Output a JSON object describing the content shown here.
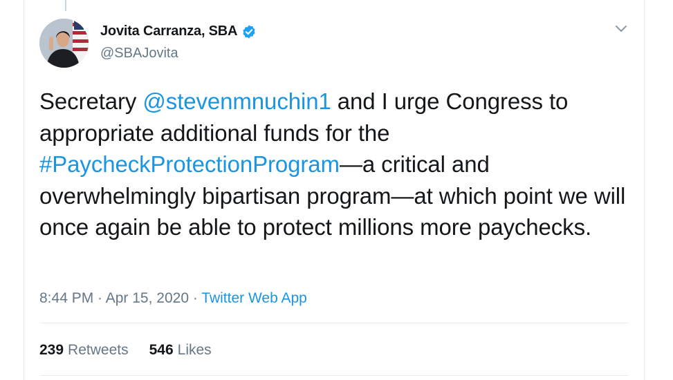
{
  "author": {
    "name": "Jovita Carranza, SBA",
    "handle": "@SBAJovita",
    "verified": true
  },
  "tweet": {
    "t1": "Secretary ",
    "mention": "@stevenmnuchin1",
    "t2": " and I urge Congress to appropriate additional funds for the ",
    "hashtag": "#PaycheckProtectionProgram",
    "t3": "—a critical and overwhelmingly bipartisan program—at which point we will once again be able to protect millions more paychecks."
  },
  "meta": {
    "time": "8:44 PM",
    "sep1": " · ",
    "date": "Apr 15, 2020",
    "sep2": " · ",
    "source": "Twitter Web App"
  },
  "stats": {
    "retweets_count": "239",
    "retweets_label": "Retweets",
    "likes_count": "546",
    "likes_label": "Likes"
  },
  "icons": {
    "verified": "verified-badge-icon",
    "caret": "chevron-down-icon"
  },
  "colors": {
    "link": "#1b95e0",
    "secondary_text": "#657786",
    "primary_text": "#14171a",
    "divider": "#e6ecf0"
  }
}
